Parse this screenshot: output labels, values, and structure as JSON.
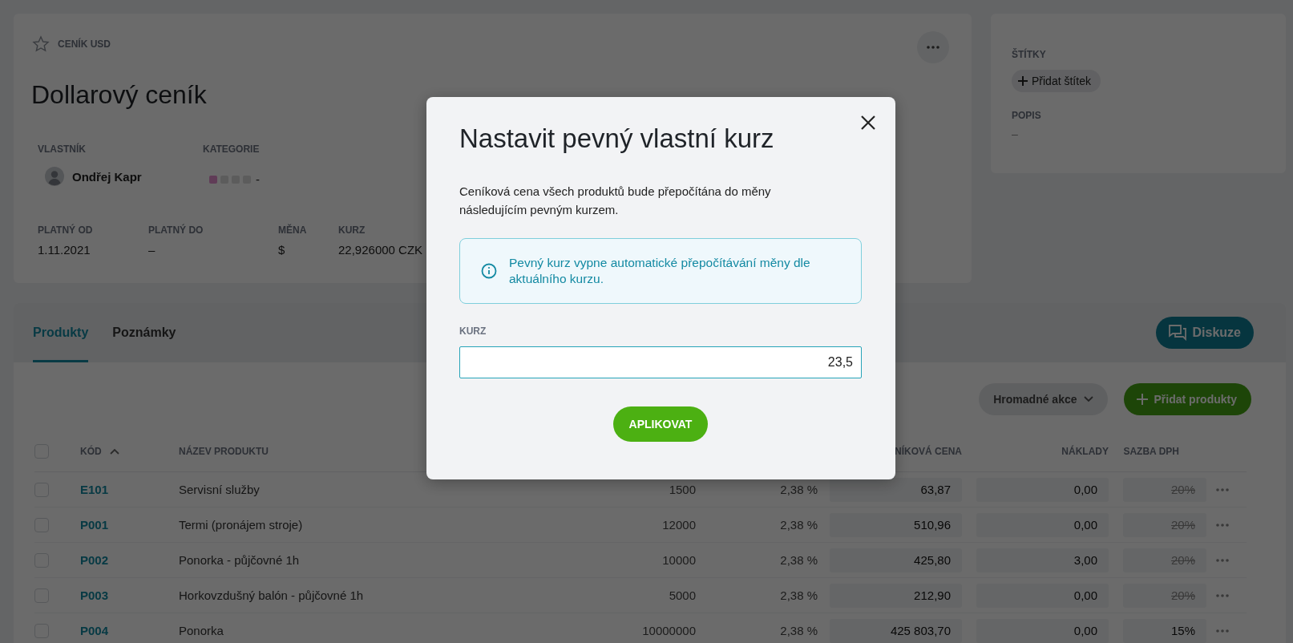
{
  "header": {
    "favorite": false,
    "breadcrumb": "CENÍK USD",
    "title": "Dollarový ceník"
  },
  "owner": {
    "label": "VLASTNÍK",
    "name": "Ondřej Kapr"
  },
  "category": {
    "label": "KATEGORIE",
    "value": "-"
  },
  "details": [
    {
      "label": "PLATNÝ OD",
      "value": "1.11.2021"
    },
    {
      "label": "PLATNÝ DO",
      "value": "–"
    },
    {
      "label": "MĚNA",
      "value": "$"
    },
    {
      "label": "KURZ",
      "value": "22,926000 CZK"
    }
  ],
  "side": {
    "tags_label": "ŠTÍTKY",
    "add_tag": "Přidat štítek",
    "description_label": "POPIS",
    "description": "–"
  },
  "tabs": [
    {
      "label": "Produkty",
      "selected": true
    },
    {
      "label": "Poznámky",
      "selected": false
    }
  ],
  "discussion_button": "Diskuze",
  "bulk_actions": "Hromadné akce",
  "add_products": "Přidat produkty",
  "table": {
    "select_all": false,
    "columns": [
      {
        "label": "KÓD",
        "sort_ascending": true
      },
      {
        "label": "NÁZEV PRODUKTU"
      },
      {
        "label": "NÍKOVÁ CENA"
      },
      {
        "label": "NÁKLADY"
      },
      {
        "label": "SAZBA DPH"
      }
    ],
    "rows": [
      {
        "selected": false,
        "code": "E101",
        "name": "Servisní služby",
        "column_4": "1500",
        "column_5": "2,38 %",
        "list_price": "63,87",
        "costs": "0,00",
        "vat": "20%",
        "vat_struck": true
      },
      {
        "selected": false,
        "code": "P001",
        "name": "Termi (pronájem stroje)",
        "column_4": "12000",
        "column_5": "2,38 %",
        "list_price": "510,96",
        "costs": "0,00",
        "vat": "20%",
        "vat_struck": true
      },
      {
        "selected": false,
        "code": "P002",
        "name": "Ponorka - půjčovné 1h",
        "column_4": "10000",
        "column_5": "2,38 %",
        "list_price": "425,80",
        "costs": "3,00",
        "vat": "20%",
        "vat_struck": true
      },
      {
        "selected": false,
        "code": "P003",
        "name": "Horkovzdušný balón - půjčovné 1h",
        "column_4": "5000",
        "column_5": "2,38 %",
        "list_price": "212,90",
        "costs": "0,00",
        "vat": "20%",
        "vat_struck": true
      },
      {
        "selected": false,
        "code": "P004",
        "name": "Ponorka",
        "column_4": "10000000",
        "column_5": "2,38 %",
        "list_price": "425 803,70",
        "costs": "0,00",
        "vat": "15%",
        "vat_struck": false
      }
    ]
  },
  "modal": {
    "title": "Nastavit pevný vlastní kurz",
    "description": "Ceníková cena všech produktů bude přepočítána do měny následujícím pevným kurzem.",
    "notice": "Pevný kurz vypne automatické přepočítávání měny dle aktuálního kurzu.",
    "field_label": "KURZ",
    "field_value": "23,5",
    "apply_button": "APLIKOVAT"
  }
}
